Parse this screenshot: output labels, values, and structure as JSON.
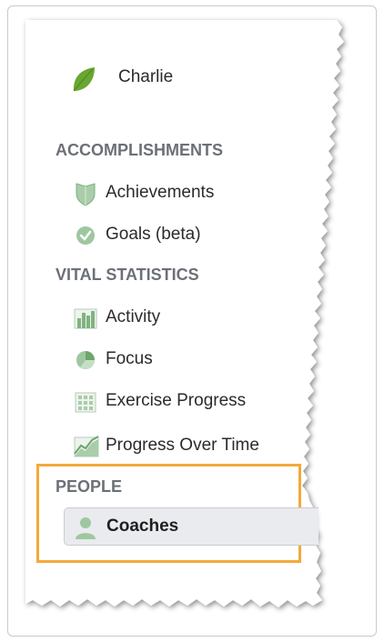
{
  "user": {
    "name": "Charlie",
    "icon": "leaf-icon"
  },
  "sections": {
    "accomplishments": {
      "title": "ACCOMPLISHMENTS",
      "items": [
        {
          "label": "Achievements",
          "icon": "shield-icon"
        },
        {
          "label": "Goals (beta)",
          "icon": "checkmark-circle-icon"
        }
      ]
    },
    "vital_statistics": {
      "title": "VITAL STATISTICS",
      "items": [
        {
          "label": "Activity",
          "icon": "bar-chart-icon"
        },
        {
          "label": "Focus",
          "icon": "pie-chart-icon"
        },
        {
          "label": "Exercise Progress",
          "icon": "grid-icon"
        },
        {
          "label": "Progress Over Time",
          "icon": "line-chart-icon"
        }
      ]
    },
    "people": {
      "title": "PEOPLE",
      "items": [
        {
          "label": "Coaches",
          "icon": "person-icon",
          "selected": true
        }
      ]
    }
  },
  "colors": {
    "highlight": "#f4a93a",
    "section_heading": "#6c7077",
    "icon_green": "#88b88c",
    "leaf_green": "#6aa632"
  }
}
